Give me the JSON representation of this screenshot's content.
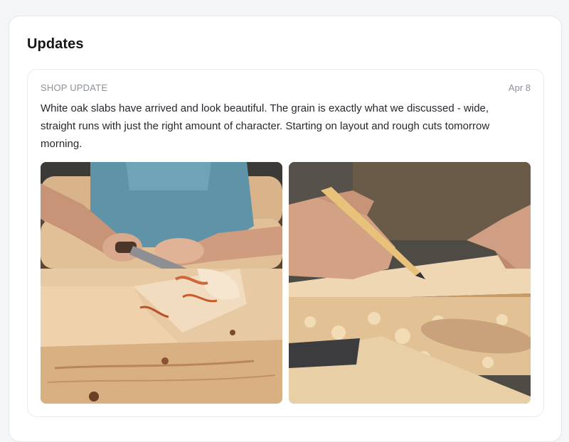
{
  "section": {
    "title": "Updates"
  },
  "update": {
    "label": "SHOP UPDATE",
    "date": "Apr 8",
    "body": "White oak slabs have arrived and look beautiful. The grain is exactly what we discussed - wide, straight runs with just the right amount of character. Starting on layout and rough cuts tomorrow morning.",
    "photos": [
      {
        "icon": "log-carving-photo"
      },
      {
        "icon": "pencil-marking-photo"
      }
    ]
  }
}
